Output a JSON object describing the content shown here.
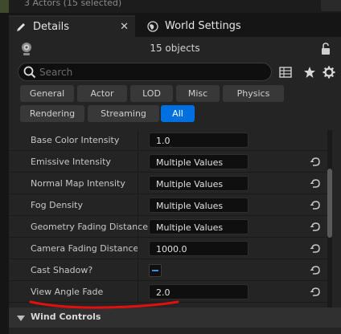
{
  "top_strip": {
    "text": "3 Actors (15 selected)"
  },
  "tabs": [
    {
      "label": "Details",
      "icon": "pencil-icon",
      "close": "✕"
    },
    {
      "label": "World Settings",
      "icon": "globe-icon"
    }
  ],
  "header": {
    "count": "15 objects"
  },
  "search": {
    "placeholder": "Search"
  },
  "filters": [
    "General",
    "Actor",
    "LOD",
    "Misc",
    "Physics",
    "Rendering",
    "Streaming",
    "All"
  ],
  "selected_filter": "All",
  "properties": [
    {
      "label": "Base Color Intensity",
      "value": "1.0",
      "reset": false
    },
    {
      "label": "Emissive Intensity",
      "value": "Multiple Values",
      "reset": true
    },
    {
      "label": "Normal Map Intensity",
      "value": "Multiple Values",
      "reset": true
    },
    {
      "label": "Fog Density",
      "value": "Multiple Values",
      "reset": true
    },
    {
      "label": "Geometry Fading Distance",
      "value": "Multiple Values",
      "reset": true
    },
    {
      "label": "Camera Fading Distance",
      "value": "1000.0",
      "reset": true
    },
    {
      "label": "Cast Shadow?",
      "value": "",
      "checkbox": "indeterminate",
      "reset": true
    },
    {
      "label": "View Angle Fade",
      "value": "2.0",
      "reset": true
    }
  ],
  "section": {
    "label": "Wind Controls"
  },
  "colors": {
    "accent": "#0070e0",
    "annotation": "#e01010",
    "panel": "#242424"
  }
}
